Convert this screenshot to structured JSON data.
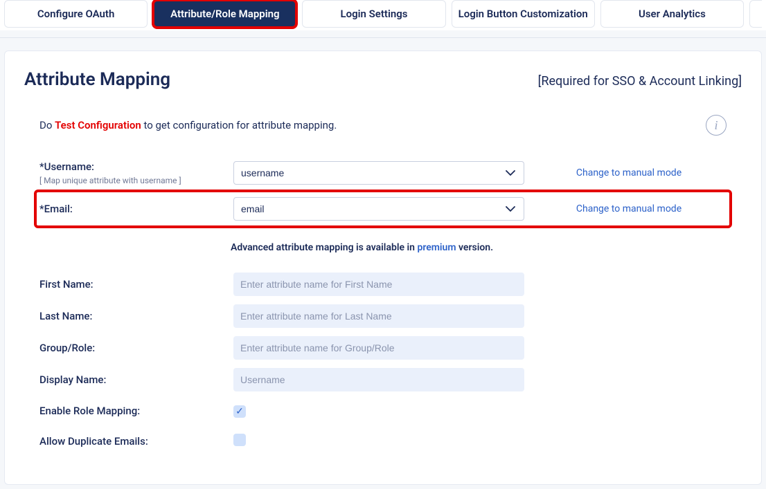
{
  "tabs": {
    "t0": "Configure OAuth",
    "t1": "Attribute/Role Mapping",
    "t2": "Login Settings",
    "t3": "Login Button Customization",
    "t4": "User Analytics"
  },
  "header": {
    "title": "Attribute Mapping",
    "subtitle": "[Required for SSO & Account Linking]"
  },
  "intro": {
    "prefix": "Do ",
    "link": "Test Configuration",
    "suffix": " to get configuration for attribute mapping."
  },
  "username_row": {
    "label": "*Username:",
    "hint": "[ Map unique attribute with username ]",
    "value": "username",
    "link": "Change to manual mode"
  },
  "email_row": {
    "label": "*Email:",
    "value": "email",
    "link": "Change to manual mode"
  },
  "midnote": {
    "p1": "Advanced attribute mapping is available in ",
    "link": "premium",
    "p2": " version."
  },
  "rows": {
    "first_name": {
      "label": "First Name:",
      "placeholder": "Enter attribute name for First Name"
    },
    "last_name": {
      "label": "Last Name:",
      "placeholder": "Enter attribute name for Last Name"
    },
    "group_role": {
      "label": "Group/Role:",
      "placeholder": "Enter attribute name for Group/Role"
    },
    "display_name": {
      "label": "Display Name:",
      "placeholder": "Username"
    },
    "enable_role": {
      "label": "Enable Role Mapping:"
    },
    "allow_dup": {
      "label": "Allow Duplicate Emails:"
    }
  },
  "icons": {
    "check": "✓"
  }
}
